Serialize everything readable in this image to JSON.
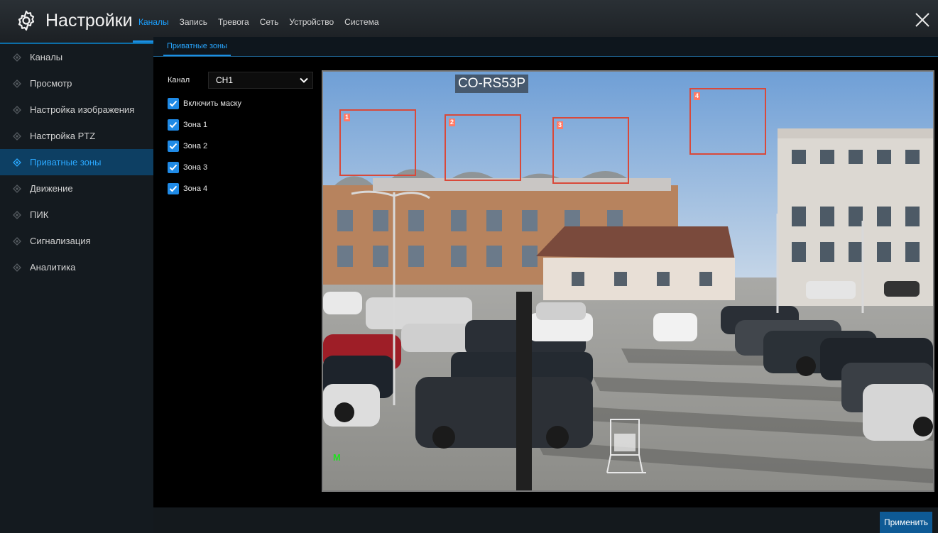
{
  "header": {
    "title": "Настройки",
    "tabs": [
      "Каналы",
      "Запись",
      "Тревога",
      "Сеть",
      "Устройство",
      "Система"
    ],
    "active_tab": "Каналы"
  },
  "sidebar": {
    "items": [
      {
        "label": "Каналы",
        "active": false
      },
      {
        "label": "Просмотр",
        "active": false
      },
      {
        "label": "Настройка изображения",
        "active": false
      },
      {
        "label": "Настройка PTZ",
        "active": false
      },
      {
        "label": "Приватные зоны",
        "active": true
      },
      {
        "label": "Движение",
        "active": false
      },
      {
        "label": "ПИК",
        "active": false
      },
      {
        "label": "Сигнализация",
        "active": false
      },
      {
        "label": "Аналитика",
        "active": false
      }
    ]
  },
  "subtabs": {
    "active": "Приватные зоны"
  },
  "form": {
    "channel_label": "Канал",
    "channel_value": "CH1",
    "checkboxes": [
      {
        "label": "Включить маску",
        "checked": true
      },
      {
        "label": "Зона 1",
        "checked": true
      },
      {
        "label": "Зона 2",
        "checked": true
      },
      {
        "label": "Зона 3",
        "checked": true
      },
      {
        "label": "Зона 4",
        "checked": true
      }
    ]
  },
  "video": {
    "osd_name": "CO-RS53P",
    "zones": [
      "1",
      "2",
      "3",
      "4"
    ],
    "marker": "M"
  },
  "footer": {
    "apply_label": "Применить"
  },
  "colors": {
    "accent": "#1a8fe3",
    "zone_border": "#d9493a",
    "active_sidebar_bg": "#0d3f63"
  },
  "icons": [
    "gear-icon",
    "close-icon",
    "bullet-icon",
    "chevron-down-icon",
    "checkmark-icon"
  ]
}
